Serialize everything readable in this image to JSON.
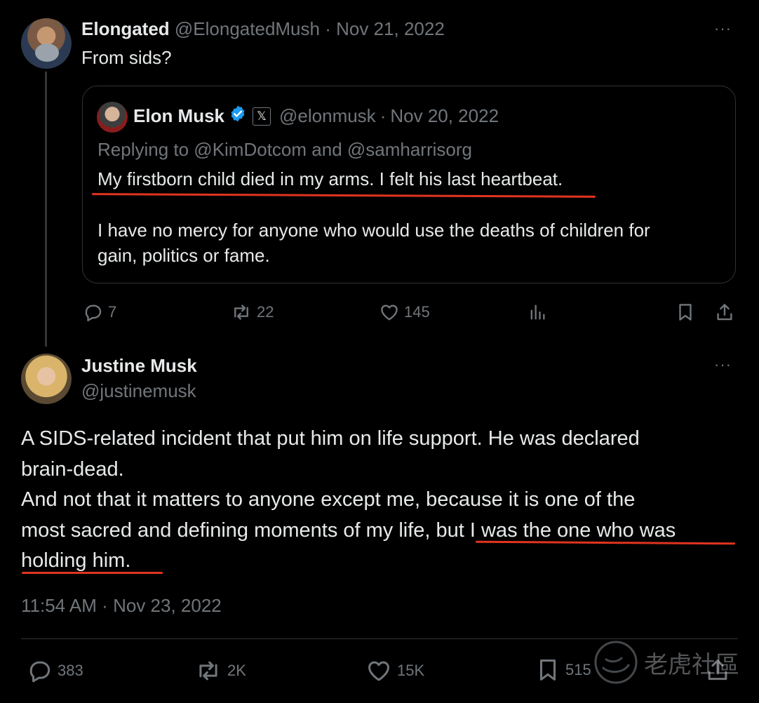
{
  "parent_tweet": {
    "display_name": "Elongated",
    "handle": "@ElongatedMush",
    "separator": "·",
    "date": "Nov 21, 2022",
    "text": "From sids?",
    "more_label": "···",
    "quoted": {
      "display_name": "Elon Musk",
      "x_badge": "𝕏",
      "handle": "@elonmusk",
      "separator": "·",
      "date": "Nov 20, 2022",
      "replying_to": "Replying to @KimDotcom and @samharrisorg",
      "line1": "My firstborn child died in my arms. I felt his last heartbeat.",
      "line2": "I have no mercy for anyone who would use the deaths of children for",
      "line3": "gain, politics or fame."
    },
    "actions": {
      "replies": "7",
      "reposts": "22",
      "likes": "145"
    }
  },
  "main_tweet": {
    "display_name": "Justine Musk",
    "handle": "@justinemusk",
    "more_label": "···",
    "line1": "A SIDS-related incident that put him on life support. He was declared",
    "line2": "brain-dead.",
    "line3": "And not that it matters to anyone except me, because it is one of the",
    "line4_a": "most sacred and defining moments of my life, ",
    "line4_b": "but I was the one who was",
    "line5": "holding him.",
    "time": "11:54 AM",
    "separator": "·",
    "date": "Nov 23, 2022",
    "actions": {
      "replies": "383",
      "reposts": "2K",
      "likes": "15K",
      "bookmarks": "515"
    }
  },
  "watermark": {
    "text": "老虎社區"
  },
  "colors": {
    "background": "#000000",
    "text": "#e7e9ea",
    "muted": "#71767b",
    "verified": "#1d9bf0",
    "underline": "#e0341f",
    "border": "#2f3336"
  }
}
